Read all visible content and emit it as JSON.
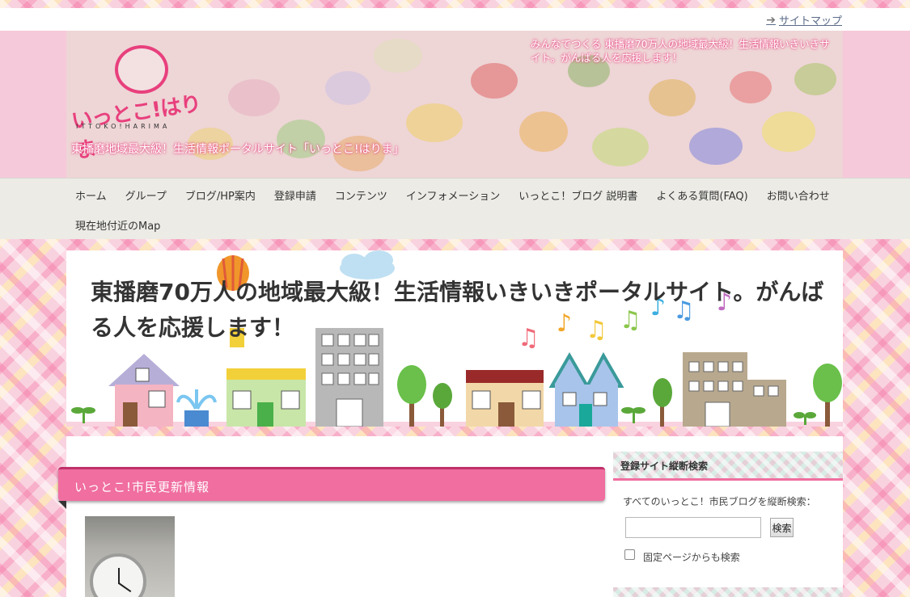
{
  "header": {
    "sitemap_label": "サイトマップ",
    "logo_text": "いっとこ!はりま",
    "logo_sub": "ITTOKO!HARIMA",
    "subtitle": "東播磨地域最大級！生活情報ポータルサイト「いっとこ!はりま」",
    "catchphrase": "みんなでつくる 東播磨70万人の地域最大級！生活情報いきいきサイト。がんばる人を応援します！"
  },
  "nav": {
    "items": [
      "ホーム",
      "グループ",
      "ブログ/HP案内",
      "登録申請",
      "コンテンツ",
      "インフォメーション",
      "いっとこ！ブログ 説明書",
      "よくある質問(FAQ)",
      "お問い合わせ",
      "現在地付近のMap"
    ]
  },
  "hero": {
    "title": "東播磨70万人の地域最大級！生活情報いきいきポータルサイト。がんばる人を応援します！"
  },
  "main": {
    "section_title": "いっとこ!市民更新情報"
  },
  "sidebar": {
    "widget_title": "登録サイト縦断検索",
    "description": "すべてのいっとこ！市民ブログを縦断検索：",
    "search_value": "",
    "search_button": "検索",
    "checkbox_label": "固定ページからも検索"
  },
  "colors": {
    "accent_pink": "#f06ea0",
    "nav_bg": "#ecebe6",
    "text": "#333333"
  }
}
